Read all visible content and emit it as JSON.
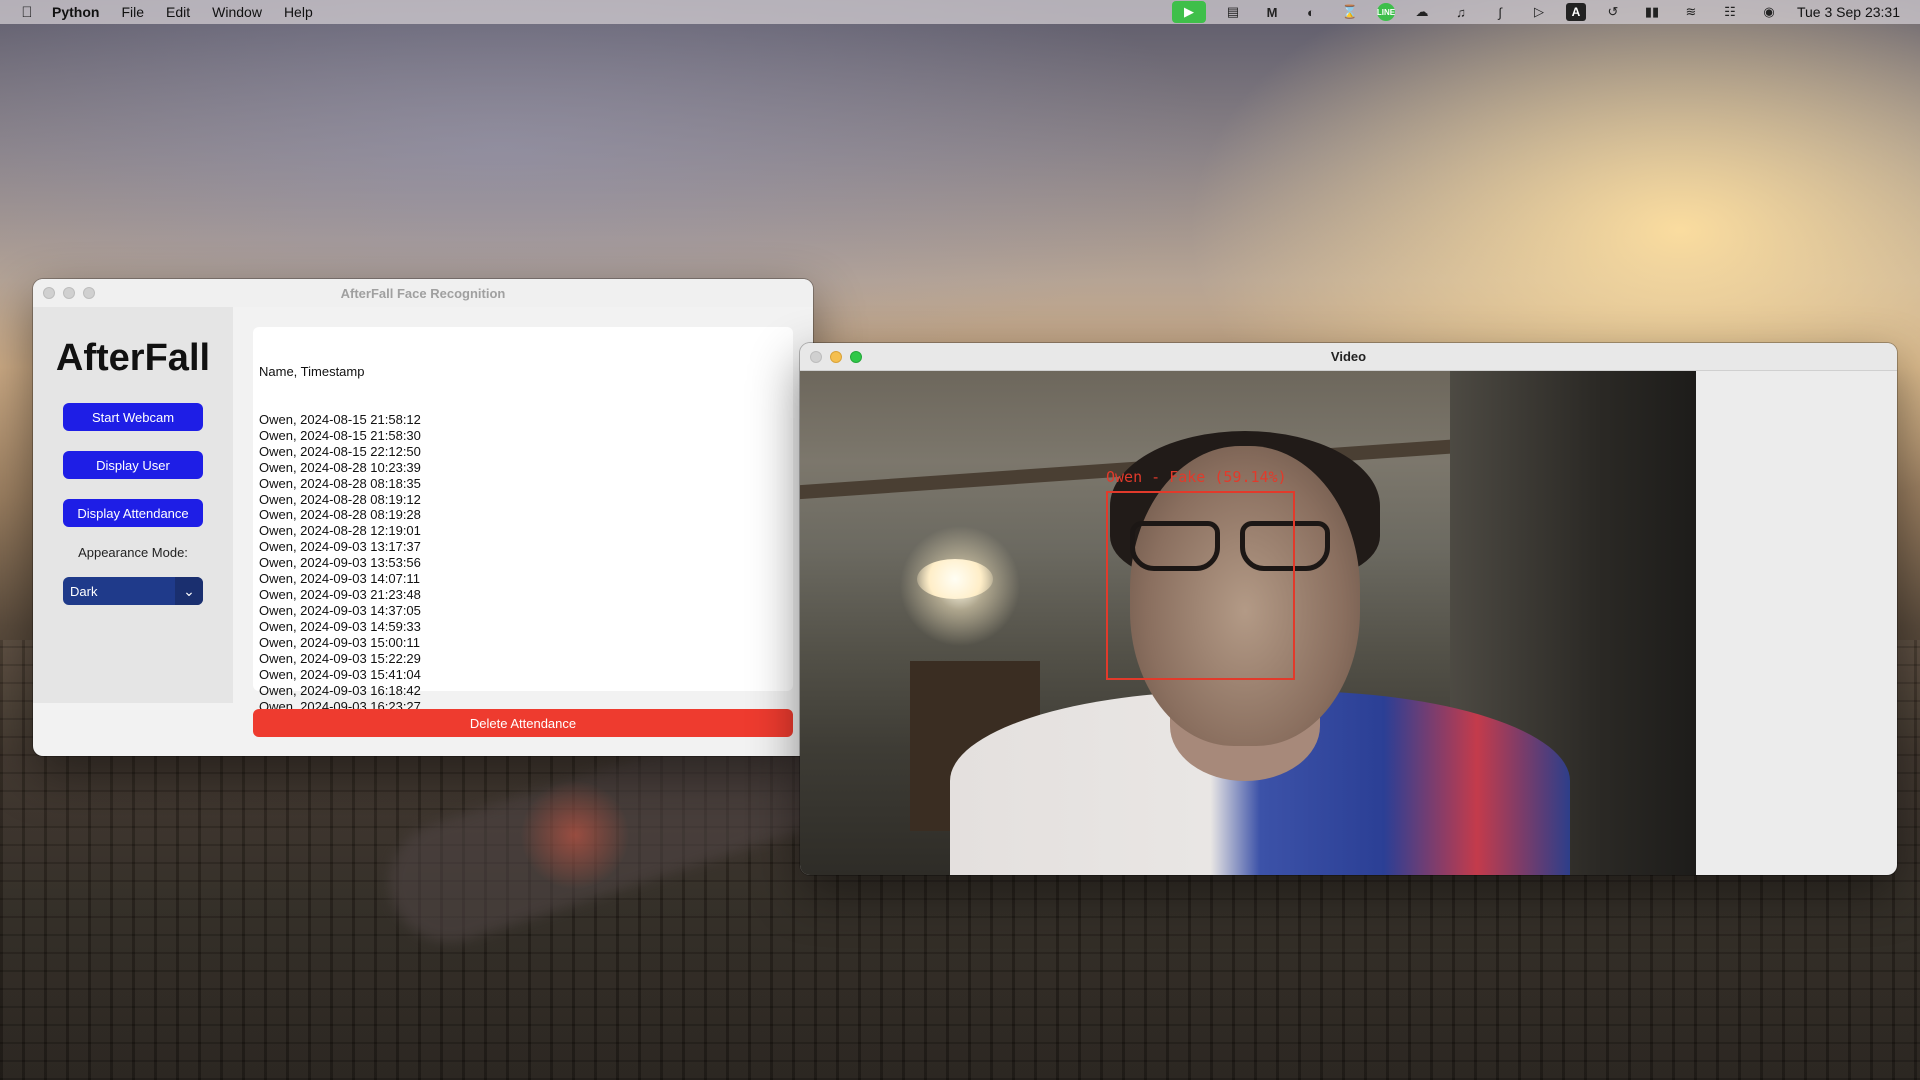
{
  "menubar": {
    "app_name": "Python",
    "menus": [
      "File",
      "Edit",
      "Window",
      "Help"
    ],
    "clock": "Tue 3 Sep  23:31",
    "status_icons": [
      "facetime-camera-icon",
      "document-icon",
      "malwarebytes-icon",
      "drive-icon",
      "hourglass-icon",
      "line-icon",
      "cloud-icon",
      "headphones-icon",
      "bluetooth-icon",
      "play-icon",
      "input-source-icon",
      "time-machine-icon",
      "battery-icon",
      "wifi-icon",
      "control-center-icon",
      "siri-icon"
    ],
    "input_source_label": "A",
    "line_label": "LINE"
  },
  "app_window": {
    "title": "AfterFall Face Recognition",
    "logo": "AfterFall",
    "buttons": {
      "start_webcam": "Start Webcam",
      "display_user": "Display User",
      "display_attendance": "Display Attendance",
      "delete_attendance": "Delete Attendance"
    },
    "appearance_label": "Appearance Mode:",
    "appearance_value": "Dark",
    "attendance_header": "Name, Timestamp",
    "attendance_rows": [
      "Owen, 2024-08-15 21:58:12",
      "Owen, 2024-08-15 21:58:30",
      "Owen, 2024-08-15 22:12:50",
      "Owen, 2024-08-28 10:23:39",
      "Owen, 2024-08-28 08:18:35",
      "Owen, 2024-08-28 08:19:12",
      "Owen, 2024-08-28 08:19:28",
      "Owen, 2024-08-28 12:19:01",
      "Owen, 2024-09-03 13:17:37",
      "Owen, 2024-09-03 13:53:56",
      "Owen, 2024-09-03 14:07:11",
      "Owen, 2024-09-03 21:23:48",
      "Owen, 2024-09-03 14:37:05",
      "Owen, 2024-09-03 14:59:33",
      "Owen, 2024-09-03 15:00:11",
      "Owen, 2024-09-03 15:22:29",
      "Owen, 2024-09-03 15:41:04",
      "Owen, 2024-09-03 16:18:42",
      "Owen, 2024-09-03 16:23:27"
    ]
  },
  "video_window": {
    "title": "Video",
    "detection_label": "Owen - Fake (59.14%)",
    "accent_color": "#e23a2b"
  }
}
